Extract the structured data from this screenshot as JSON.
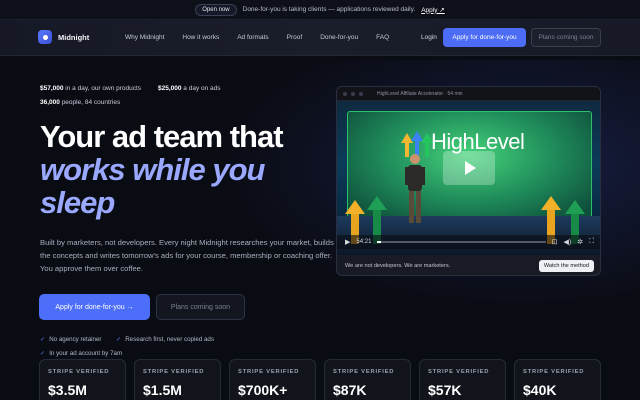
{
  "announce": {
    "pill": "Open now",
    "text": "Done-for-you is taking clients — applications reviewed daily.",
    "apply": "Apply ↗"
  },
  "nav": {
    "brand": "Midnight",
    "links": [
      "Why Midnight",
      "How it works",
      "Ad formats",
      "Proof",
      "Done-for-you",
      "FAQ"
    ],
    "login": "Login",
    "apply": "Apply for done-for-you",
    "plans": "Plans coming soon"
  },
  "hero": {
    "stats": [
      {
        "strong": "$57,000",
        "rest": " in a day, our own products"
      },
      {
        "strong": "$25,000",
        "rest": " a day on ads"
      },
      {
        "strong": "36,000",
        "rest": " people, 84 countries"
      }
    ],
    "headline_1": "Your ad team that",
    "headline_2": "works while you",
    "headline_3": "sleep",
    "sub": "Built by marketers, not developers. Every night Midnight researches your market, builds the concepts and writes tomorrow's ads for your course, membership or coaching offer. You approve them over coffee.",
    "apply": "Apply for done-for-you →",
    "plans": "Plans coming soon",
    "checks": [
      "No agency retainer",
      "Research first, never copied ads",
      "In your ad account by 7am"
    ]
  },
  "video": {
    "title": "HighLevel Affiliate Accelerator · 54 min",
    "screen_text": "HighLevel",
    "time": "54:21",
    "progress": 0.02,
    "caption": "We are not developers. We are marketers.",
    "watch": "Watch the method"
  },
  "stripe": [
    {
      "label": "STRIPE VERIFIED",
      "value": "$3.5M"
    },
    {
      "label": "STRIPE VERIFIED",
      "value": "$1.5M"
    },
    {
      "label": "STRIPE VERIFIED",
      "value": "$700K+"
    },
    {
      "label": "STRIPE VERIFIED",
      "value": "$87K"
    },
    {
      "label": "STRIPE VERIFIED",
      "value": "$57K"
    },
    {
      "label": "STRIPE VERIFIED",
      "value": "$40K"
    }
  ],
  "colors": {
    "accent": "#4d6ef8",
    "headline_accent": "#9aa8ff",
    "background": "#0a0c14"
  }
}
